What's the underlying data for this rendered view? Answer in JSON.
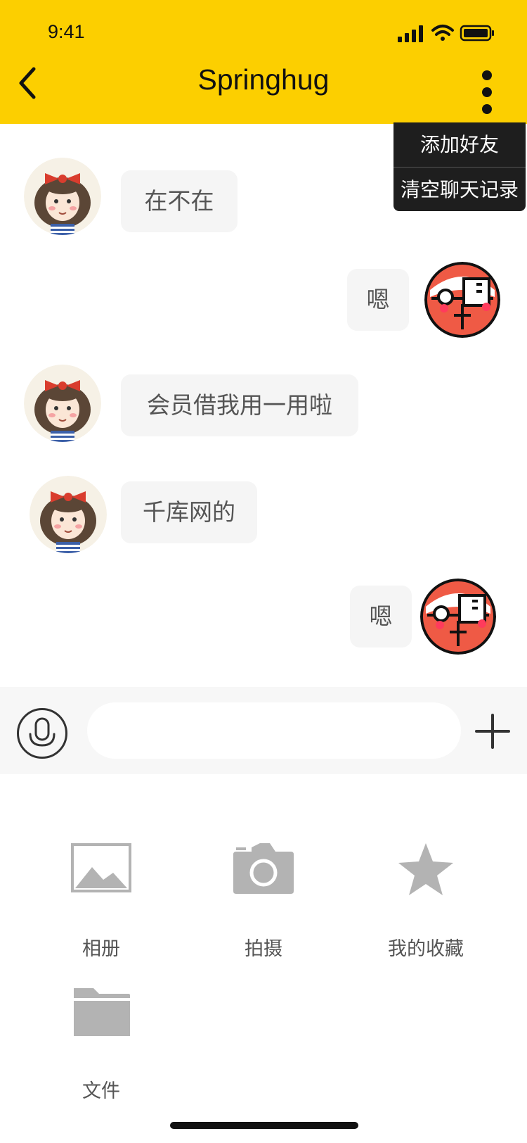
{
  "status_bar": {
    "time": "9:41"
  },
  "header": {
    "title": "Springhug",
    "background_color": "#FCCF00",
    "back_icon": "chevron-left-icon",
    "more_icon": "vertical-dots-icon"
  },
  "popup_menu": {
    "items": [
      {
        "label": "添加好友"
      },
      {
        "label": "清空聊天记录"
      }
    ]
  },
  "messages": [
    {
      "side": "left",
      "avatar": "girl-avatar",
      "text": "在不在"
    },
    {
      "side": "right",
      "avatar": "red-face-avatar",
      "text": "嗯"
    },
    {
      "side": "left",
      "avatar": "girl-avatar",
      "text": "会员借我用一用啦"
    },
    {
      "side": "left",
      "avatar": "girl-avatar",
      "text": "千库网的"
    },
    {
      "side": "right",
      "avatar": "red-face-avatar",
      "text": "嗯"
    }
  ],
  "input_bar": {
    "voice_icon": "microphone-icon",
    "input_value": "",
    "plus_icon": "plus-icon"
  },
  "tools": [
    {
      "label": "相册",
      "icon": "image-icon"
    },
    {
      "label": "拍摄",
      "icon": "camera-icon"
    },
    {
      "label": "我的收藏",
      "icon": "star-icon"
    },
    {
      "label": "文件",
      "icon": "folder-icon"
    }
  ]
}
